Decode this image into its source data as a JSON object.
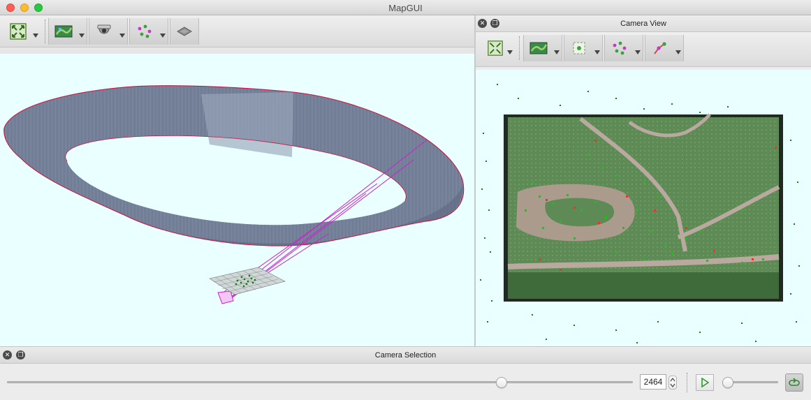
{
  "window": {
    "title": "MapGUI"
  },
  "main_toolbar": {
    "buttons": [
      {
        "icon": "fit-extent-icon",
        "has_menu": true
      },
      {
        "icon": "image-layer-icon",
        "has_menu": true
      },
      {
        "icon": "camera-icon",
        "has_menu": true
      },
      {
        "icon": "landmarks-icon",
        "has_menu": true
      },
      {
        "icon": "depth-surface-icon",
        "has_menu": false
      }
    ]
  },
  "camera_view": {
    "title": "Camera View",
    "toolbar": [
      "fit-extent-icon",
      "image-layer-icon",
      "camera-frame-icon",
      "landmarks-icon",
      "tracks-icon"
    ]
  },
  "camera_selection": {
    "title": "Camera Selection",
    "frame_value": "2464",
    "frame_slider_fraction": 0.79,
    "speed_slider_fraction": 0.1
  },
  "colors": {
    "viewport_bg": "#eaffff",
    "surface": "#7d8aa0",
    "surface_edge": "#cc1144",
    "frustum": "#cc22cc",
    "landmark": "#1a7a1a"
  }
}
